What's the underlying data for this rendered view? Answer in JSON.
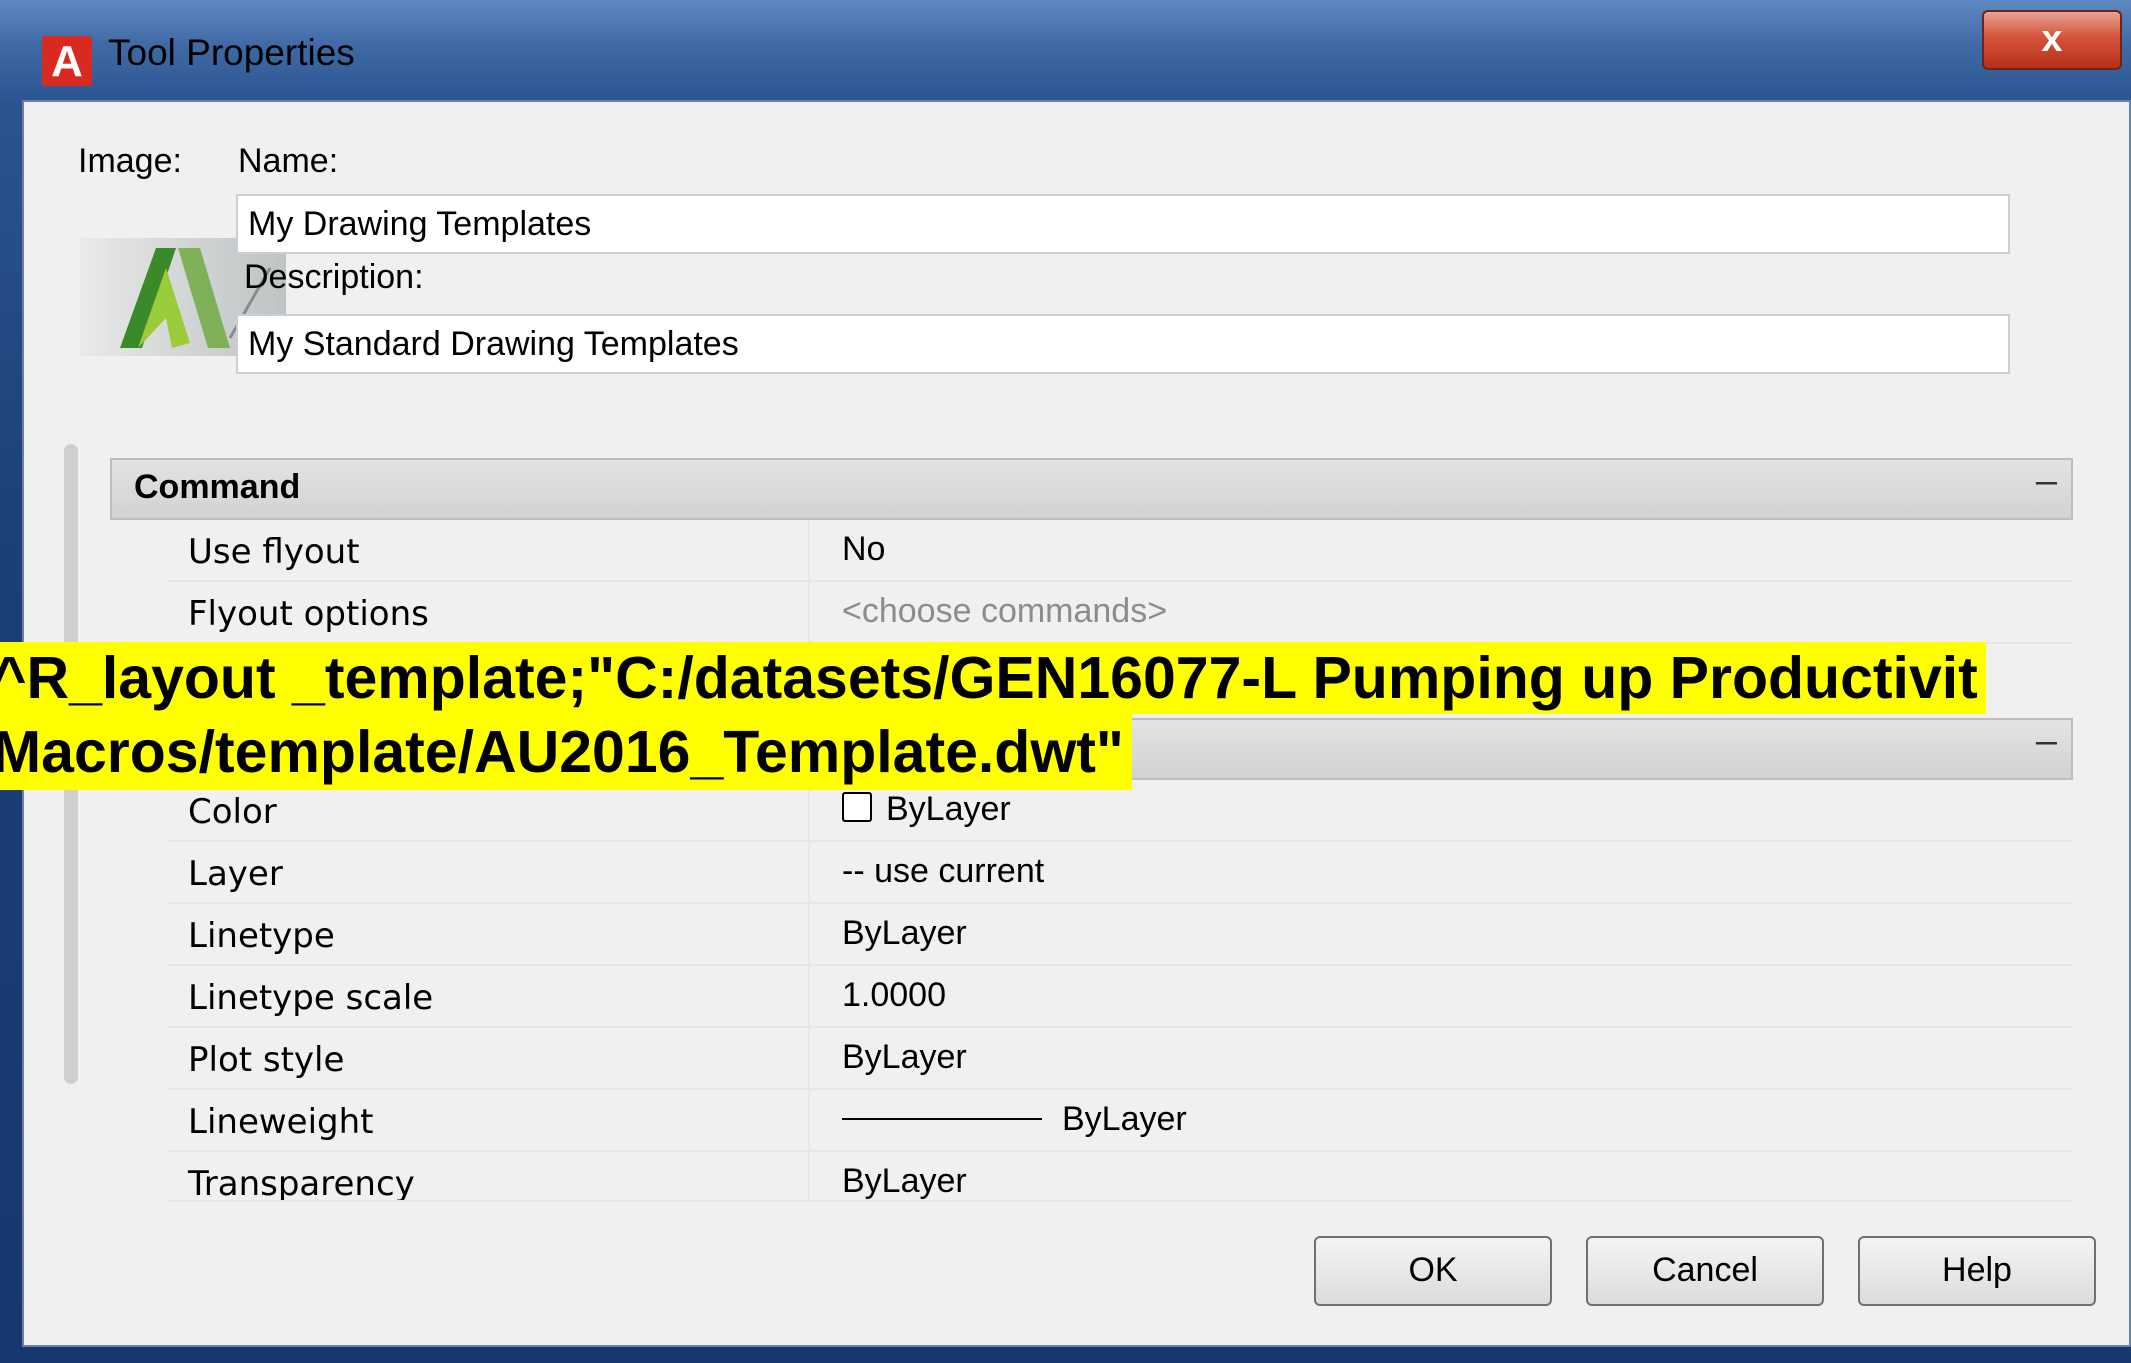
{
  "window": {
    "title": "Tool Properties",
    "app_icon_glyph": "A",
    "close_glyph": "x"
  },
  "form": {
    "image_label": "Image:",
    "name_label": "Name:",
    "name_value": "My Drawing Templates",
    "description_label": "Description:",
    "description_value": "My Standard Drawing Templates"
  },
  "sections": {
    "command": {
      "title": "Command",
      "collapse_glyph": "–",
      "rows": [
        {
          "name": "Use flyout",
          "value": "No"
        },
        {
          "name": "Flyout options",
          "value": "<choose commands>"
        }
      ]
    },
    "general": {
      "collapse_glyph": "–",
      "rows": [
        {
          "name": "Color",
          "value": "ByLayer"
        },
        {
          "name": "Layer",
          "value": "-- use current"
        },
        {
          "name": "Linetype",
          "value": "ByLayer"
        },
        {
          "name": "Linetype scale",
          "value": "1.0000"
        },
        {
          "name": "Plot style",
          "value": "ByLayer"
        },
        {
          "name": "Lineweight",
          "value": "ByLayer"
        },
        {
          "name": "Transparency",
          "value": "ByLayer"
        }
      ]
    }
  },
  "buttons": {
    "ok": "OK",
    "cancel": "Cancel",
    "help": "Help"
  },
  "overlay": {
    "line1": "^R_layout _template;\"C:/datasets/GEN16077-L Pumping up Productivit",
    "line2": "Macros/template/AU2016_Template.dwt\""
  },
  "colors": {
    "titlebar": "#3f6aa5",
    "close_button": "#d4533b",
    "overlay_highlight": "#ffff00",
    "dialog_background": "#f0f0f0"
  },
  "icons": {
    "app": "autocad-logo-icon",
    "tool_image": "autocad-tool-image",
    "close": "close-icon"
  }
}
